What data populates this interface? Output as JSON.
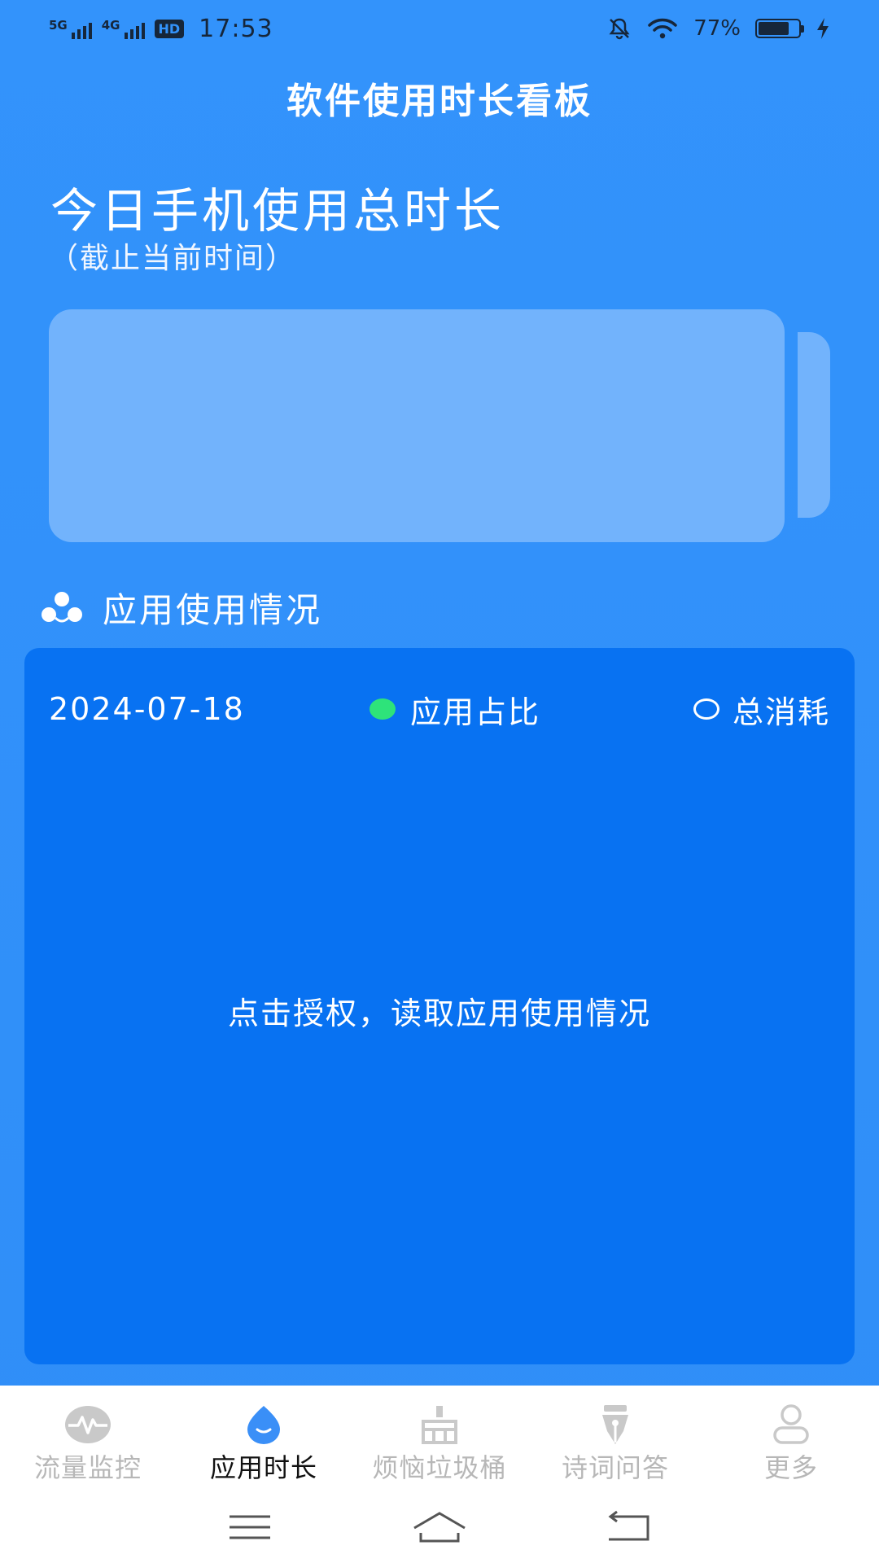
{
  "status_bar": {
    "net1": "5G",
    "net2": "4G",
    "hd": "HD",
    "time": "17:53",
    "battery_pct": "77%",
    "battery_level": 0.77
  },
  "header": {
    "title": "软件使用时长看板"
  },
  "today": {
    "title": "今日手机使用总时长",
    "subtitle": "（截止当前时间）"
  },
  "section": {
    "title": "应用使用情况"
  },
  "card": {
    "date": "2024-07-18",
    "legend_app_share": "应用占比",
    "legend_total": "总消耗",
    "authorize_prompt": "点击授权，读取应用使用情况"
  },
  "nav": {
    "items": [
      {
        "label": "流量监控"
      },
      {
        "label": "应用时长"
      },
      {
        "label": "烦恼垃圾桶"
      },
      {
        "label": "诗词问答"
      },
      {
        "label": "更多"
      }
    ],
    "active_index": 1
  },
  "colors": {
    "background": "#3393fb",
    "card": "#0872f2",
    "battery_graphic": "#72b3fc",
    "legend_active_dot": "#2ee37a",
    "nav_active_icon": "#3a8ff7"
  }
}
